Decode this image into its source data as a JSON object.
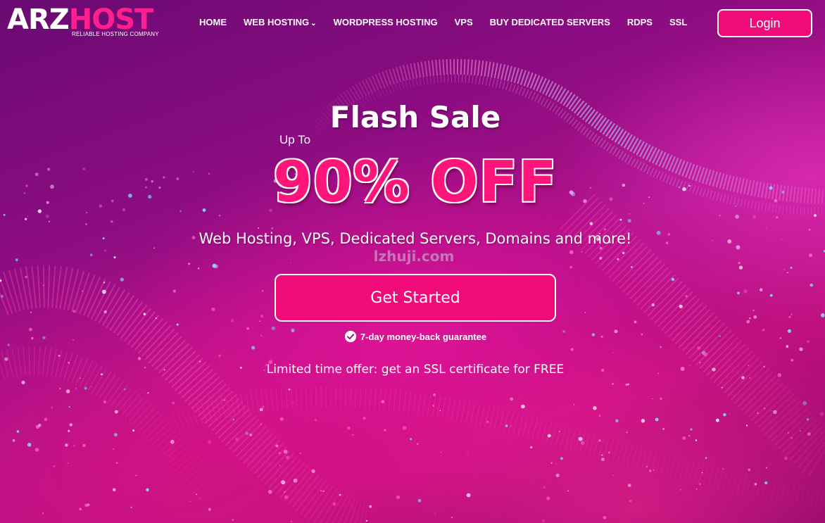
{
  "logo": {
    "part1": "ARZ",
    "part2": "HOST",
    "tagline": "RELIABLE HOSTING COMPANY"
  },
  "nav": {
    "items": [
      {
        "label": "HOME"
      },
      {
        "label": "WEB HOSTING",
        "has_dropdown": true
      },
      {
        "label": "WORDPRESS HOSTING"
      },
      {
        "label": "VPS"
      },
      {
        "label": "BUY DEDICATED SERVERS"
      },
      {
        "label": "RDPS"
      },
      {
        "label": "SSL"
      }
    ],
    "login_label": "Login"
  },
  "hero": {
    "headline": "Flash Sale",
    "prefix": "Up To",
    "discount": "90% OFF",
    "subtitle": "Web Hosting, VPS, Dedicated Servers, Domains and more!",
    "watermark": "lzhuji.com",
    "cta_label": "Get Started",
    "guarantee": "7-day money-back guarantee",
    "offer": "Limited time offer: get an SSL certificate for FREE"
  },
  "colors": {
    "accent": "#f00a7a",
    "brand_pink": "#ff1f8e",
    "background_purple": "#8a0c80"
  },
  "icons": {
    "chevron": "chevron-down-icon",
    "check": "check-circle-icon"
  }
}
